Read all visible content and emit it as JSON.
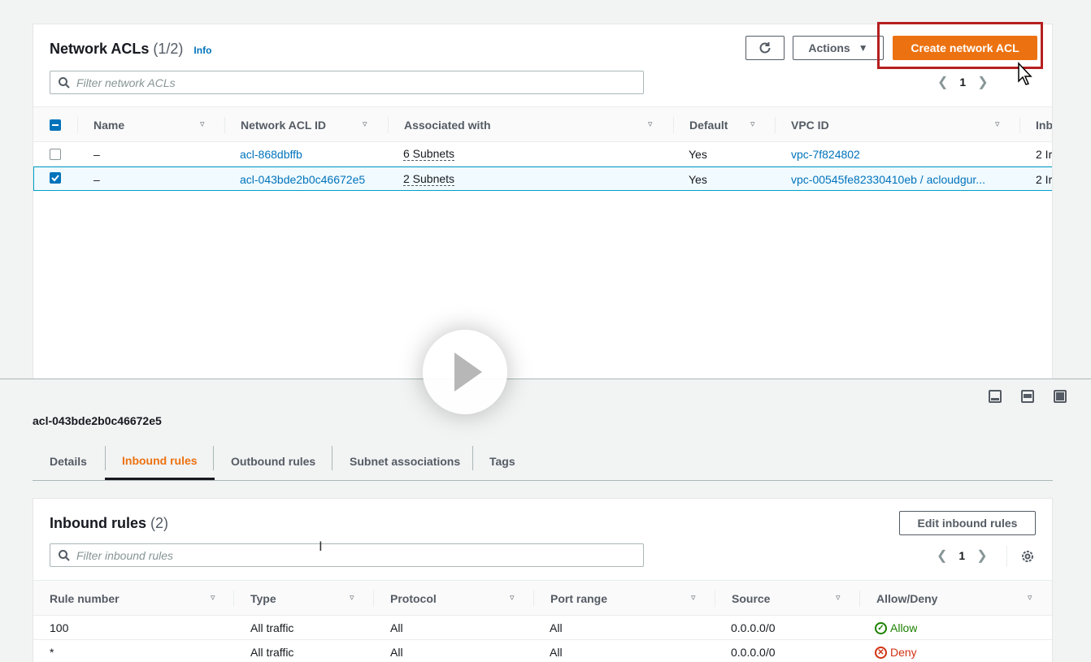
{
  "acl_panel": {
    "title": "Network ACLs",
    "count": "(1/2)",
    "info": "Info",
    "refresh_icon": "refresh-icon",
    "actions_label": "Actions",
    "create_label": "Create network ACL",
    "search_placeholder": "Filter network ACLs",
    "page": "1",
    "columns": [
      "Name",
      "Network ACL ID",
      "Associated with",
      "Default",
      "VPC ID",
      "Inb"
    ],
    "rows": [
      {
        "name": "–",
        "acl_id": "acl-868dbffb",
        "associated": "6 Subnets",
        "default": "Yes",
        "vpc": "vpc-7f824802",
        "inbound": "2 Ir",
        "checked": false
      },
      {
        "name": "–",
        "acl_id": "acl-043bde2b0c46672e5",
        "associated": "2 Subnets",
        "default": "Yes",
        "vpc": "vpc-00545fe82330410eb / acloudgur...",
        "inbound": "2 Ir",
        "checked": true
      }
    ]
  },
  "detail": {
    "title": "acl-043bde2b0c46672e5",
    "tabs": [
      "Details",
      "Inbound rules",
      "Outbound rules",
      "Subnet associations",
      "Tags"
    ],
    "active_tab": "Inbound rules"
  },
  "inbound": {
    "title": "Inbound rules",
    "count": "(2)",
    "edit_label": "Edit inbound rules",
    "search_placeholder": "Filter inbound rules",
    "page": "1",
    "columns": [
      "Rule number",
      "Type",
      "Protocol",
      "Port range",
      "Source",
      "Allow/Deny"
    ],
    "rows": [
      {
        "rule": "100",
        "type": "All traffic",
        "protocol": "All",
        "port": "All",
        "source": "0.0.0.0/0",
        "action": "Allow"
      },
      {
        "rule": "*",
        "type": "All traffic",
        "protocol": "All",
        "port": "All",
        "source": "0.0.0.0/0",
        "action": "Deny"
      }
    ]
  },
  "colors": {
    "primary": "#ec7211",
    "link": "#0073bb",
    "allow": "#1d8102",
    "deny": "#d13212",
    "highlight": "#b51f1f"
  }
}
